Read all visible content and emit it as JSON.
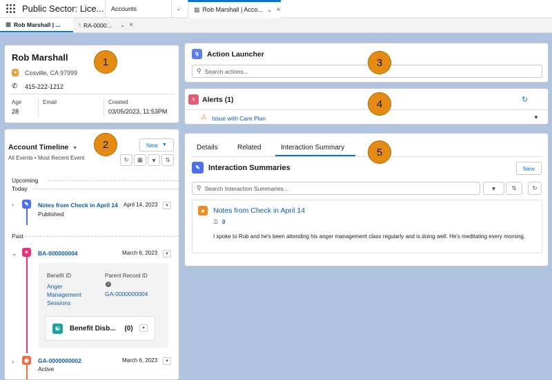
{
  "header": {
    "app_name": "Public Sector: Lice...",
    "tabs": [
      {
        "label": "Accounts"
      },
      {
        "label": "Rob Marshall | Acco..."
      }
    ]
  },
  "subtabs": [
    {
      "label": "Rob Marshall | ..."
    },
    {
      "label": "RA-0000..."
    }
  ],
  "profile": {
    "name": "Rob Marshall",
    "address": "Cosville, CA 97999",
    "phone": "415-222-1212",
    "fields": [
      {
        "label": "Age",
        "value": "28"
      },
      {
        "label": "Email",
        "value": ""
      },
      {
        "label": "Created",
        "value": "03/05/2023, 11:53PM"
      }
    ]
  },
  "timeline": {
    "title": "Account Timeline",
    "filter": "All Events • Most Recent Event",
    "new_label": "New",
    "upcoming_label": "Upcoming",
    "today_label": "Today",
    "past_label": "Past",
    "items": [
      {
        "title": "Notes from Check in April 14",
        "date": "April 14, 2023",
        "status": "Published"
      },
      {
        "title": "BA-000000004",
        "date": "March 6, 2023"
      },
      {
        "title": "GA-0000000002",
        "date": "March 6, 2023",
        "status": "Active"
      }
    ],
    "detail": {
      "benefit_id_label": "Benefit ID",
      "benefit_id_value": "Anger Management Sessions",
      "parent_label": "Parent Record ID",
      "parent_value": "GA-0000000004",
      "related_title": "Benefit Disb...",
      "related_count": "(0)"
    }
  },
  "action_launcher": {
    "title": "Action Launcher",
    "placeholder": "Search actions..."
  },
  "alerts": {
    "title": "Alerts (1)",
    "item": "Issue with Care Plan"
  },
  "interaction": {
    "tabs": [
      {
        "label": "Details"
      },
      {
        "label": "Related"
      },
      {
        "label": "Interaction Summary"
      }
    ],
    "title": "Interaction Summaries",
    "new_label": "New",
    "placeholder": "Search Interaction Summaries...",
    "record": {
      "title": "Notes from Check in April 14",
      "count": "0",
      "body": "I spoke to Rob and he's been attending his anger management class regularly and is doing well. He's meditating every morning."
    }
  },
  "callouts": [
    "1",
    "2",
    "3",
    "4",
    "5"
  ],
  "colors": {
    "accent": "#0176d3",
    "callout": "#e38b12",
    "timeline_blue": "#4c6ef5",
    "timeline_pink": "#e8327c",
    "timeline_orange": "#f26b3a",
    "alert_red": "#ea5a6e"
  }
}
